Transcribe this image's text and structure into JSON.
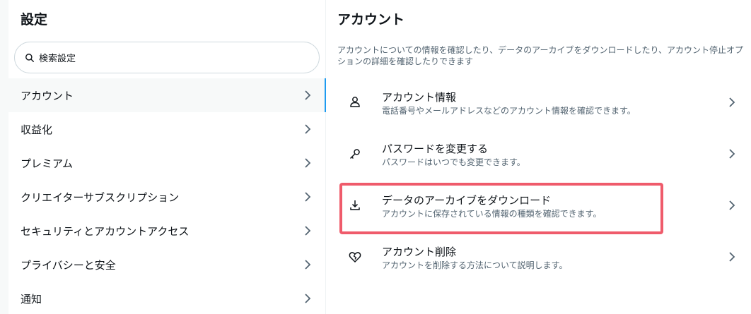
{
  "left": {
    "title": "設定",
    "search": {
      "placeholder": "検索設定",
      "icon": "search-icon"
    },
    "items": [
      {
        "label": "アカウント",
        "active": true
      },
      {
        "label": "収益化"
      },
      {
        "label": "プレミアム"
      },
      {
        "label": "クリエイターサブスクリプション"
      },
      {
        "label": "セキュリティとアカウントアクセス"
      },
      {
        "label": "プライバシーと安全"
      },
      {
        "label": "通知"
      }
    ]
  },
  "right": {
    "title": "アカウント",
    "description": "アカウントについての情報を確認したり、データのアーカイブをダウンロードしたり、アカウント停止オプションの詳細を確認したりできます",
    "options": [
      {
        "title": "アカウント情報",
        "subtitle": "電話番号やメールアドレスなどのアカウント情報を確認できます。",
        "icon": "person-icon"
      },
      {
        "title": "パスワードを変更する",
        "subtitle": "パスワードはいつでも変更できます。",
        "icon": "key-icon"
      },
      {
        "title": "データのアーカイブをダウンロード",
        "subtitle": "アカウントに保存されている情報の種類を確認できます。",
        "icon": "download-icon",
        "highlighted": true
      },
      {
        "title": "アカウント削除",
        "subtitle": "アカウントを削除する方法について説明します。",
        "icon": "broken-heart-icon"
      }
    ]
  },
  "colors": {
    "accent": "#1d9bf0",
    "highlight": "#ef5b6b",
    "secondary_text": "#536471"
  }
}
